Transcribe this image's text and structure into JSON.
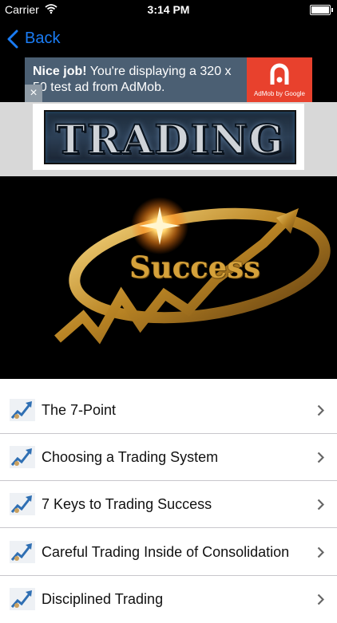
{
  "status_bar": {
    "carrier": "Carrier",
    "time": "3:14 PM"
  },
  "nav": {
    "back_label": "Back"
  },
  "ad": {
    "headline": "Nice job!",
    "body": " You're displaying a 320 x 50 test ad from AdMob.",
    "brand": "AdMob by Google",
    "close": "×"
  },
  "header": {
    "logo_text": "TRADING"
  },
  "hero": {
    "word": "Success"
  },
  "list": {
    "items": [
      {
        "label": "The 7-Point"
      },
      {
        "label": "Choosing a Trading System"
      },
      {
        "label": "7 Keys to Trading Success"
      },
      {
        "label": "Careful Trading Inside of Consolidation"
      },
      {
        "label": "Disciplined Trading"
      }
    ]
  },
  "colors": {
    "accent": "#1a7cf4",
    "ad_bg": "#4b5f73",
    "admob_red": "#e8412d",
    "gold": "#d5a13a"
  }
}
